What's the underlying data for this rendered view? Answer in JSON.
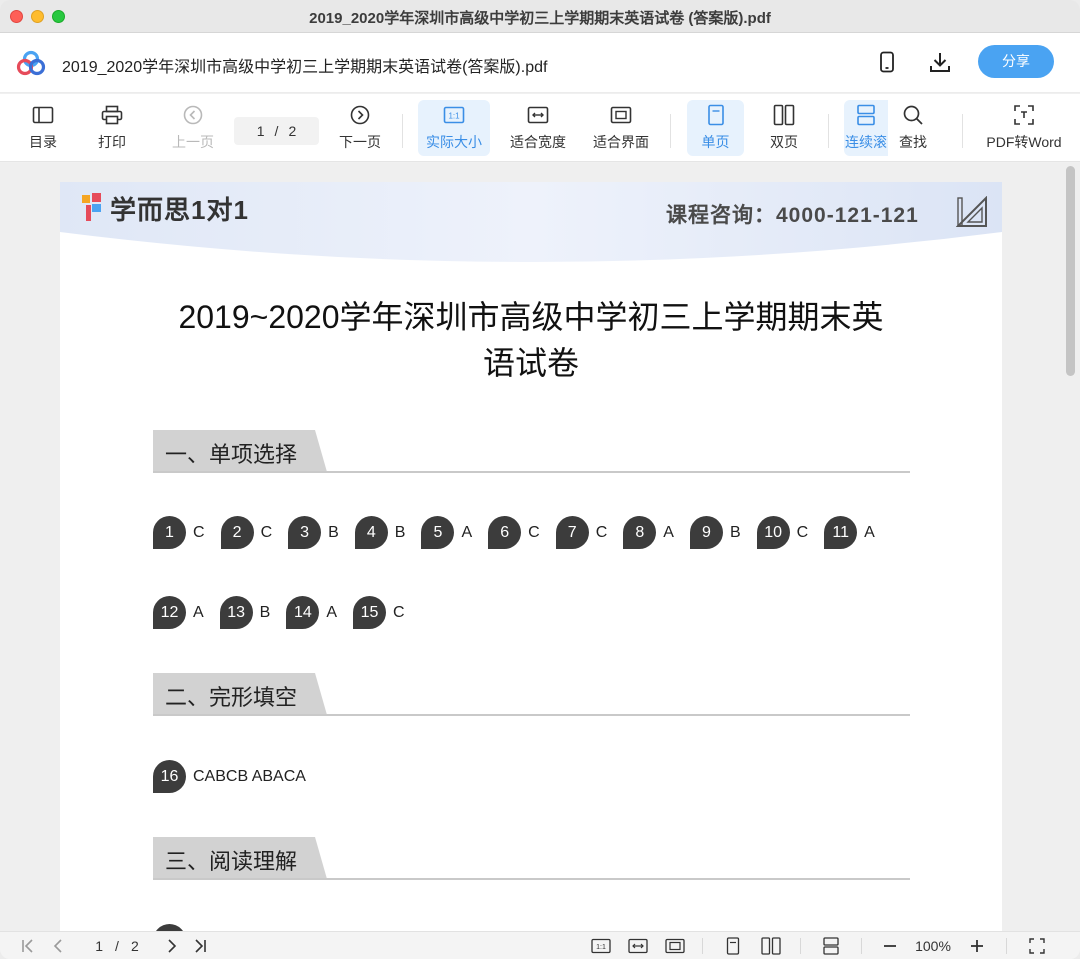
{
  "window": {
    "title": "2019_2020学年深圳市高级中学初三上学期期末英语试卷 (答案版).pdf"
  },
  "header": {
    "file_name": "2019_2020学年深圳市高级中学初三上学期期末英语试卷(答案版).pdf",
    "share_label": "分享",
    "icons": [
      "phone-icon",
      "download-icon"
    ]
  },
  "toolbar": {
    "toc": "目录",
    "print": "打印",
    "prev": "上一页",
    "page_current": "1",
    "page_sep": "/",
    "page_total": "2",
    "next": "下一页",
    "actual_size": "实际大小",
    "fit_width": "适合宽度",
    "fit_window": "适合界面",
    "single": "单页",
    "double": "双页",
    "continuous": "连续滚",
    "find": "查找",
    "pdf_to_word": "PDF转Word",
    "actual_size_icon_text": "1:1"
  },
  "document": {
    "brand": "学而思1对1",
    "consult": "课程咨询：4000-121-121",
    "title_line1": "2019~2020学年深圳市高级中学初三上学期期末英",
    "title_line2": "语试卷",
    "sections": [
      {
        "title": "一、单项选择"
      },
      {
        "title": "二、完形填空"
      },
      {
        "title": "三、阅读理解"
      }
    ],
    "answers_row1": [
      {
        "num": "1",
        "ans": "C"
      },
      {
        "num": "2",
        "ans": "C"
      },
      {
        "num": "3",
        "ans": "B"
      },
      {
        "num": "4",
        "ans": "B"
      },
      {
        "num": "5",
        "ans": "A"
      },
      {
        "num": "6",
        "ans": "C"
      },
      {
        "num": "7",
        "ans": "C"
      },
      {
        "num": "8",
        "ans": "A"
      },
      {
        "num": "9",
        "ans": "B"
      },
      {
        "num": "10",
        "ans": "C"
      },
      {
        "num": "11",
        "ans": "A"
      }
    ],
    "answers_row2": [
      {
        "num": "12",
        "ans": "A"
      },
      {
        "num": "13",
        "ans": "B"
      },
      {
        "num": "14",
        "ans": "A"
      },
      {
        "num": "15",
        "ans": "C"
      }
    ],
    "cloze": {
      "num": "16",
      "text": "CABCB  ABACA"
    }
  },
  "bottombar": {
    "page_current": "1",
    "page_sep": "/",
    "page_total": "2",
    "zoom": "100%",
    "actual_size_icon_text": "1:1"
  },
  "colors": {
    "accent": "#4aa3f2",
    "active_bg": "#e7f2fd",
    "bubble": "#3c3c3c"
  }
}
